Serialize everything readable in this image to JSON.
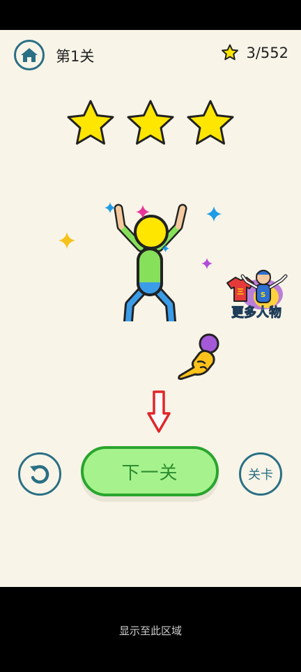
{
  "header": {
    "level_label": "第1关",
    "star_count": "3/552"
  },
  "result": {
    "stars_earned": 3,
    "stars_total": 3
  },
  "more_characters_label": "更多人物",
  "buttons": {
    "next_label": "下一关",
    "levels_label": "关卡"
  },
  "footer_note": "显示至此区域",
  "colors": {
    "background": "#f8f4e8",
    "accent": "#2a6f84",
    "star": "#ffe600",
    "next_fill": "#a6f38e",
    "next_border": "#2aa52e",
    "arrow": "#e0262a"
  },
  "icons": [
    "home-icon",
    "star-icon",
    "restart-icon",
    "pointing-hand-icon",
    "down-arrow-icon"
  ]
}
